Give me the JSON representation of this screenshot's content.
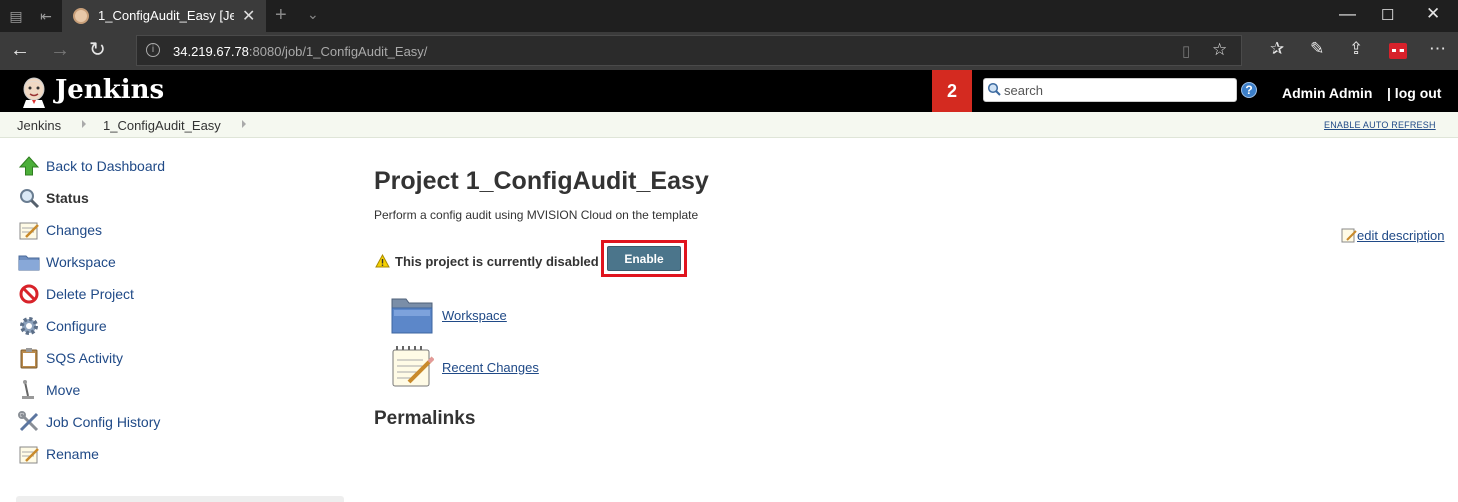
{
  "browser": {
    "tab_title": "1_ConfigAudit_Easy [Jer",
    "address_host": "34.219.67.78",
    "address_rest": ":8080/job/1_ConfigAudit_Easy/"
  },
  "header": {
    "brand": "Jenkins",
    "badge": "2",
    "search_placeholder": "search",
    "help": "?",
    "user": "Admin Admin",
    "logout": "| log out"
  },
  "breadcrumb": {
    "items": [
      "Jenkins",
      "1_ConfigAudit_Easy"
    ],
    "auto_refresh": "ENABLE AUTO REFRESH"
  },
  "sidebar": {
    "items": [
      {
        "label": "Back to Dashboard",
        "icon": "up-arrow-icon"
      },
      {
        "label": "Status",
        "icon": "magnifier-icon"
      },
      {
        "label": "Changes",
        "icon": "notepad-icon"
      },
      {
        "label": "Workspace",
        "icon": "folder-icon"
      },
      {
        "label": "Delete Project",
        "icon": "no-entry-icon"
      },
      {
        "label": "Configure",
        "icon": "gear-icon"
      },
      {
        "label": "SQS Activity",
        "icon": "clipboard-icon"
      },
      {
        "label": "Move",
        "icon": "move-icon"
      },
      {
        "label": "Job Config History",
        "icon": "tools-icon"
      },
      {
        "label": "Rename",
        "icon": "notepad-icon"
      }
    ]
  },
  "main": {
    "title": "Project 1_ConfigAudit_Easy",
    "description": "Perform a config audit using MVISION Cloud on the template",
    "edit_description": "edit description",
    "disabled_message": "This project is currently disabled",
    "enable_label": "Enable",
    "links": [
      {
        "label": "Workspace",
        "icon": "folder-icon"
      },
      {
        "label": "Recent Changes",
        "icon": "notepad-icon"
      }
    ],
    "permalinks_heading": "Permalinks"
  },
  "colors": {
    "header_bg": "#000000",
    "badge_red": "#d42a20",
    "link_blue": "#204a87",
    "enable_button": "#4b758b",
    "highlight_frame": "#e0141e"
  }
}
